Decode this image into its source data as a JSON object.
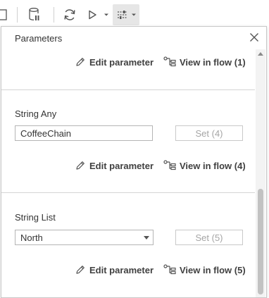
{
  "toolbar": {
    "icons": [
      "document-icon",
      "database-icon",
      "refresh-icon",
      "run-icon",
      "dropdown-icon",
      "parameters-icon"
    ]
  },
  "panel": {
    "title": "Parameters",
    "sections": [
      {
        "edit_label": "Edit parameter",
        "view_label": "View in flow (1)"
      },
      {
        "label": "String Any",
        "value": "CoffeeChain",
        "set_label": "Set (4)",
        "edit_label": "Edit parameter",
        "view_label": "View in flow (4)"
      },
      {
        "label": "String List",
        "selected": "North",
        "set_label": "Set (5)",
        "edit_label": "Edit parameter",
        "view_label": "View in flow (5)"
      }
    ]
  },
  "colors": {
    "border": "#c8c8c8",
    "disabled_text": "#a5a5a5",
    "text": "#333333"
  }
}
